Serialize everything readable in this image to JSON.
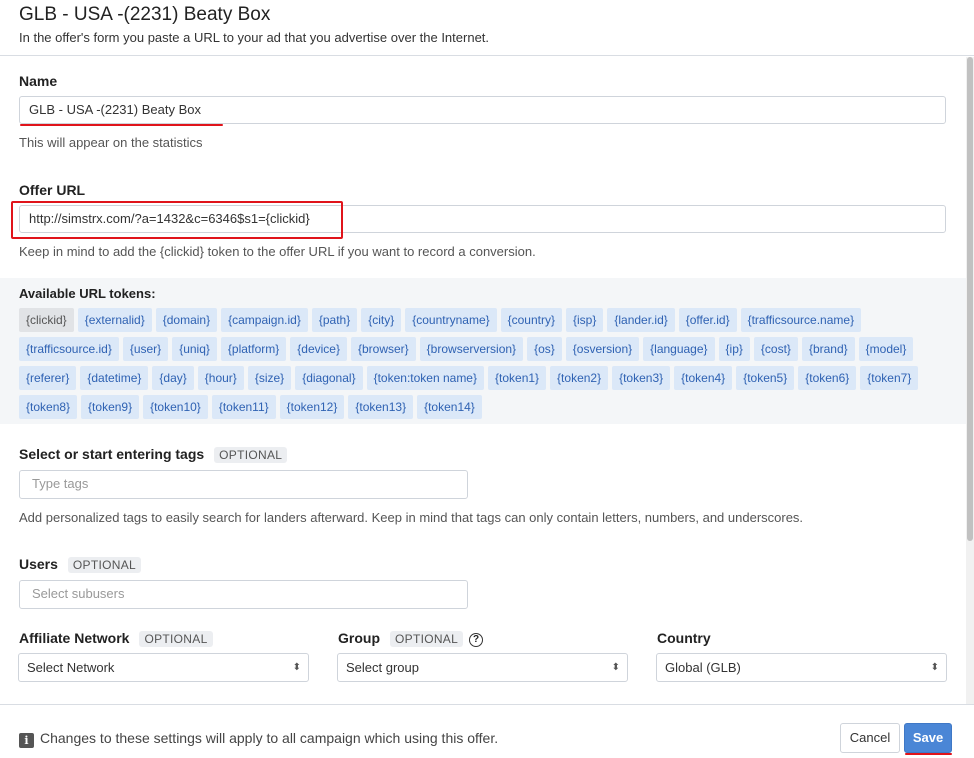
{
  "header": {
    "title": "GLB - USA -(2231) Beaty Box",
    "subtitle": "In the offer's form you paste a URL to your ad that you advertise over the Internet."
  },
  "name_field": {
    "label": "Name",
    "value": "GLB - USA -(2231) Beaty Box",
    "hint": "This will appear on the statistics"
  },
  "offer_url": {
    "label": "Offer URL",
    "value": "http://simstrx.com/?a=1432&c=6346$s1={clickid}",
    "hint": "Keep in mind to add the {clickid} token to the offer URL if you want to record a conversion."
  },
  "tokens": {
    "label": "Available URL tokens:",
    "items": [
      "{clickid}",
      "{externalid}",
      "{domain}",
      "{campaign.id}",
      "{path}",
      "{city}",
      "{countryname}",
      "{country}",
      "{isp}",
      "{lander.id}",
      "{offer.id}",
      "{trafficsource.name}",
      "{trafficsource.id}",
      "{user}",
      "{uniq}",
      "{platform}",
      "{device}",
      "{browser}",
      "{browserversion}",
      "{os}",
      "{osversion}",
      "{language}",
      "{ip}",
      "{cost}",
      "{brand}",
      "{model}",
      "{referer}",
      "{datetime}",
      "{day}",
      "{hour}",
      "{size}",
      "{diagonal}",
      "{token:token name}",
      "{token1}",
      "{token2}",
      "{token3}",
      "{token4}",
      "{token5}",
      "{token6}",
      "{token7}",
      "{token8}",
      "{token9}",
      "{token10}",
      "{token11}",
      "{token12}",
      "{token13}",
      "{token14}"
    ]
  },
  "tags": {
    "label": "Select or start entering tags",
    "optional": "OPTIONAL",
    "placeholder": "Type tags",
    "hint": "Add personalized tags to easily search for landers afterward. Keep in mind that tags can only contain letters, numbers, and underscores."
  },
  "users": {
    "label": "Users",
    "optional": "OPTIONAL",
    "placeholder": "Select subusers"
  },
  "affiliate_network": {
    "label": "Affiliate Network",
    "optional": "OPTIONAL",
    "value": "Select Network"
  },
  "group": {
    "label": "Group",
    "optional": "OPTIONAL",
    "value": "Select group",
    "help": "?"
  },
  "country": {
    "label": "Country",
    "value": "Global (GLB)"
  },
  "footer": {
    "info": "i",
    "note": "Changes to these settings will apply to all campaign which using this offer.",
    "cancel_label": "Cancel",
    "save_label": "Save"
  },
  "colors": {
    "accent": "#4a86d6",
    "token_bg": "#dbe8f8",
    "token_text": "#2f62b3",
    "annotation_red": "#e0141b"
  },
  "icons": {
    "select_arrows": "⌃⌄",
    "info": "info-icon",
    "help": "question-circle-icon"
  }
}
